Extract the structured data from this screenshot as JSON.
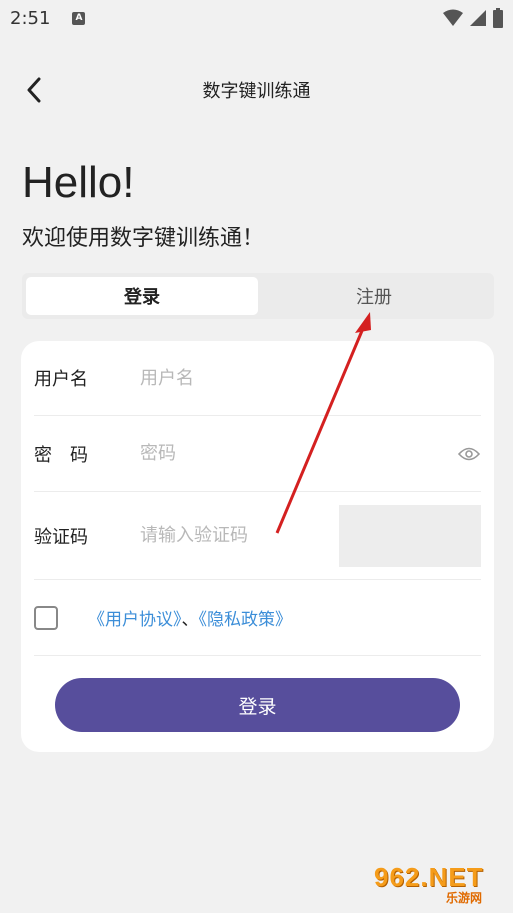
{
  "status_bar": {
    "time": "2:51",
    "app_icon_letter": "A"
  },
  "app_bar": {
    "title": "数字键训练通"
  },
  "hero": {
    "greeting": "Hello!",
    "welcome": "欢迎使用数字键训练通！"
  },
  "tabs": [
    {
      "label": "登录",
      "active": true
    },
    {
      "label": "注册",
      "active": false
    }
  ],
  "form": {
    "username": {
      "label": "用户名",
      "placeholder": "用户名",
      "value": ""
    },
    "password": {
      "label": "密　码",
      "placeholder": "密码",
      "value": ""
    },
    "captcha": {
      "label": "验证码",
      "placeholder": "请输入验证码",
      "value": ""
    },
    "agreement": {
      "checked": false,
      "user_agreement": "《用户协议》",
      "separator": "、",
      "privacy_policy": "《隐私政策》"
    },
    "submit_label": "登录"
  },
  "colors": {
    "primary": "#574e9c",
    "link": "#3c8ed8",
    "annotation": "#d42020"
  },
  "watermark": {
    "main": "962.NET",
    "sub": "乐游网"
  }
}
